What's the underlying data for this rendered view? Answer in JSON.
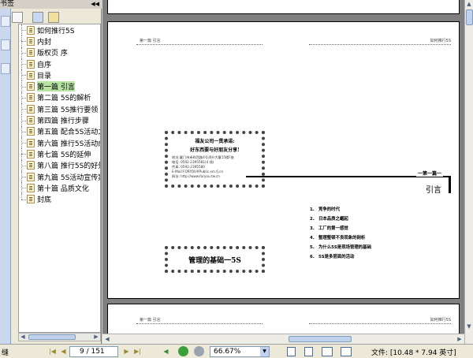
{
  "panel": {
    "title": "书签",
    "collapse_glyph": "◀◀"
  },
  "bookmarks": [
    {
      "label": "如何推行5S",
      "selected": false
    },
    {
      "label": "内封",
      "selected": false
    },
    {
      "label": "版权页 序",
      "selected": false
    },
    {
      "label": "自序",
      "selected": false
    },
    {
      "label": "目录",
      "selected": false
    },
    {
      "label": "第一篇 引言",
      "selected": true
    },
    {
      "label": "第二篇 5S的解析",
      "selected": false
    },
    {
      "label": "第三篇 5S推行要领",
      "selected": false
    },
    {
      "label": "第四篇 推行步骤",
      "selected": false
    },
    {
      "label": "第五篇 配合5S活动之",
      "selected": false
    },
    {
      "label": "第六篇 推行5S活动成",
      "selected": false
    },
    {
      "label": "第七篇 5S的延伸",
      "selected": false
    },
    {
      "label": "第八篇 推行5S的好处",
      "selected": false
    },
    {
      "label": "第九篇 5S活动宣传案",
      "selected": false
    },
    {
      "label": "第十篇 品质文化",
      "selected": false
    },
    {
      "label": "封底",
      "selected": false
    }
  ],
  "page": {
    "left_header": "第一篇  引言",
    "right_header": "如何推行5S",
    "card": {
      "title": "福友公司一贯承诺:",
      "slogan": "好东西要与好朋友分享!",
      "lines": [
        "地址:厦门市禾祥西路4号鸿升大厦15楼F座",
        "电话: 0592-2395581(4 线)",
        "传真: 0592-2395580",
        "E-Mail:FORYOU#Public.xm.fj.cn",
        "网址: http://www.foryou.tw.cn"
      ]
    },
    "main_title": "管理的基础一5S",
    "chapter_label": "一第一篇一",
    "chapter_title": "引言",
    "toc": [
      {
        "num": "1.",
        "text": "竞争的时代"
      },
      {
        "num": "2.",
        "text": "日本品质之崛起"
      },
      {
        "num": "3.",
        "text": "工厂的第一感觉"
      },
      {
        "num": "4.",
        "text": "整理整顿不良现象的剖析"
      },
      {
        "num": "5.",
        "text": "为什么5S是现场管理的基础"
      },
      {
        "num": "6.",
        "text": "5S是多层面的活动"
      }
    ]
  },
  "status": {
    "left_text": "缝",
    "page_display": "9 / 151",
    "zoom": "66.67%",
    "file_size": "文件: [10.48 * 7.94 英寸]"
  },
  "colors": {
    "selected_highlight": "#b8e4a3",
    "panel_bg": "#ece9d8",
    "doc_bg": "#7f7f7f"
  }
}
